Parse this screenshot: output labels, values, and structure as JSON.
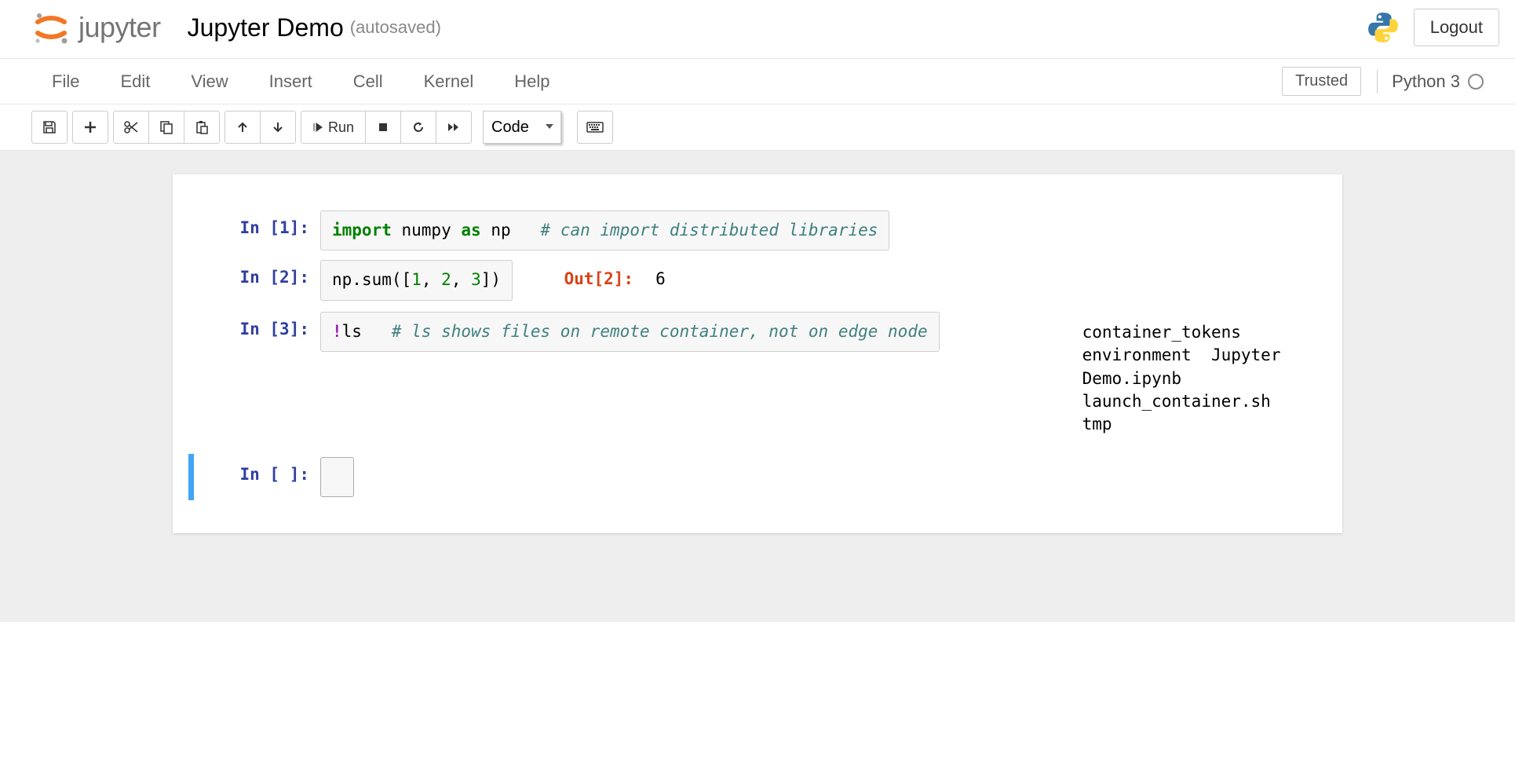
{
  "header": {
    "logo_text": "jupyter",
    "notebook_name": "Jupyter Demo",
    "autosave": "(autosaved)",
    "logout": "Logout"
  },
  "menubar": {
    "items": [
      "File",
      "Edit",
      "View",
      "Insert",
      "Cell",
      "Kernel",
      "Help"
    ],
    "trusted": "Trusted",
    "kernel_name": "Python 3"
  },
  "toolbar": {
    "run_label": "Run",
    "cell_type": "Code"
  },
  "cells": [
    {
      "prompt_in": "In [1]:",
      "code_tokens": [
        {
          "t": "import",
          "c": "cm-keyword"
        },
        {
          "t": " numpy ",
          "c": ""
        },
        {
          "t": "as",
          "c": "cm-keyword"
        },
        {
          "t": " np   ",
          "c": ""
        },
        {
          "t": "# can import distributed libraries",
          "c": "cm-comment"
        }
      ]
    },
    {
      "prompt_in": "In [2]:",
      "code_tokens": [
        {
          "t": "np",
          "c": ""
        },
        {
          "t": ".",
          "c": ""
        },
        {
          "t": "sum",
          "c": ""
        },
        {
          "t": "(",
          "c": ""
        },
        {
          "t": "[",
          "c": ""
        },
        {
          "t": "1",
          "c": "cm-number"
        },
        {
          "t": ", ",
          "c": ""
        },
        {
          "t": "2",
          "c": "cm-number"
        },
        {
          "t": ", ",
          "c": ""
        },
        {
          "t": "3",
          "c": "cm-number"
        },
        {
          "t": "]",
          "c": ""
        },
        {
          "t": ")",
          "c": ""
        }
      ],
      "prompt_out": "Out[2]:",
      "output_result": "6"
    },
    {
      "prompt_in": "In [3]:",
      "code_tokens": [
        {
          "t": "!",
          "c": "cm-magic"
        },
        {
          "t": "ls   ",
          "c": ""
        },
        {
          "t": "# ls shows files on remote container, not on edge node",
          "c": "cm-comment"
        }
      ],
      "output_stream": "container_tokens  environment  Jupyter Demo.ipynb  launch_container.sh\ntmp"
    },
    {
      "prompt_in": "In [ ]:",
      "code_tokens": [
        {
          "t": " ",
          "c": ""
        }
      ],
      "selected": true
    }
  ]
}
